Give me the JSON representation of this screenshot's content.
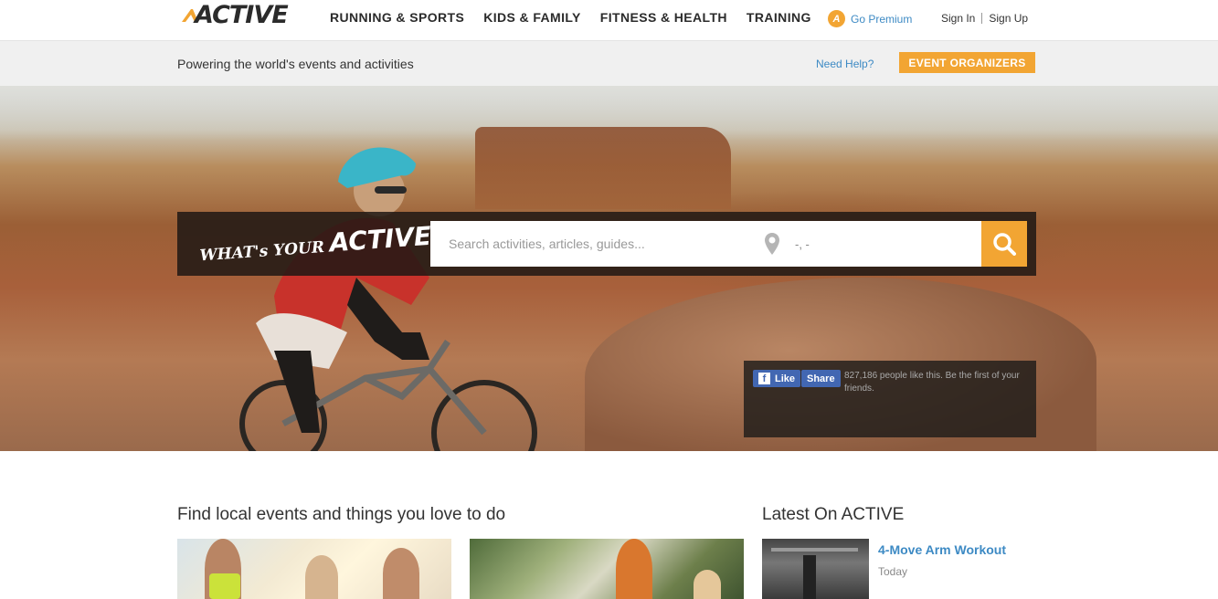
{
  "brand": {
    "logo_text": "ACTIVE",
    "accent": "#f2a533",
    "link_color": "#3d8ac4"
  },
  "nav": {
    "items": [
      {
        "label": "RUNNING & SPORTS"
      },
      {
        "label": "KIDS & FAMILY"
      },
      {
        "label": "FITNESS & HEALTH"
      },
      {
        "label": "TRAINING"
      }
    ],
    "premium_badge": "A",
    "premium_label": "Go Premium",
    "sign_in": "Sign In",
    "sign_up": "Sign Up"
  },
  "subbar": {
    "tagline": "Powering the world's events and activities",
    "need_help": "Need Help?",
    "organizers": "EVENT ORGANIZERS"
  },
  "hero": {
    "slogan_small": "WHAT's YOUR",
    "slogan_big": "ACTIVE?",
    "search_placeholder": "Search activities, articles, guides...",
    "location_value": "-, -",
    "search_icon": "search-icon",
    "location_icon": "map-pin-icon"
  },
  "facebook": {
    "like_label": "Like",
    "share_label": "Share",
    "text": "827,186 people like this. Be the first of your friends."
  },
  "events": {
    "title": "Find local events and things you love to do"
  },
  "latest": {
    "title": "Latest On ACTIVE",
    "items": [
      {
        "title": "4-Move Arm Workout",
        "date": "Today"
      }
    ]
  }
}
